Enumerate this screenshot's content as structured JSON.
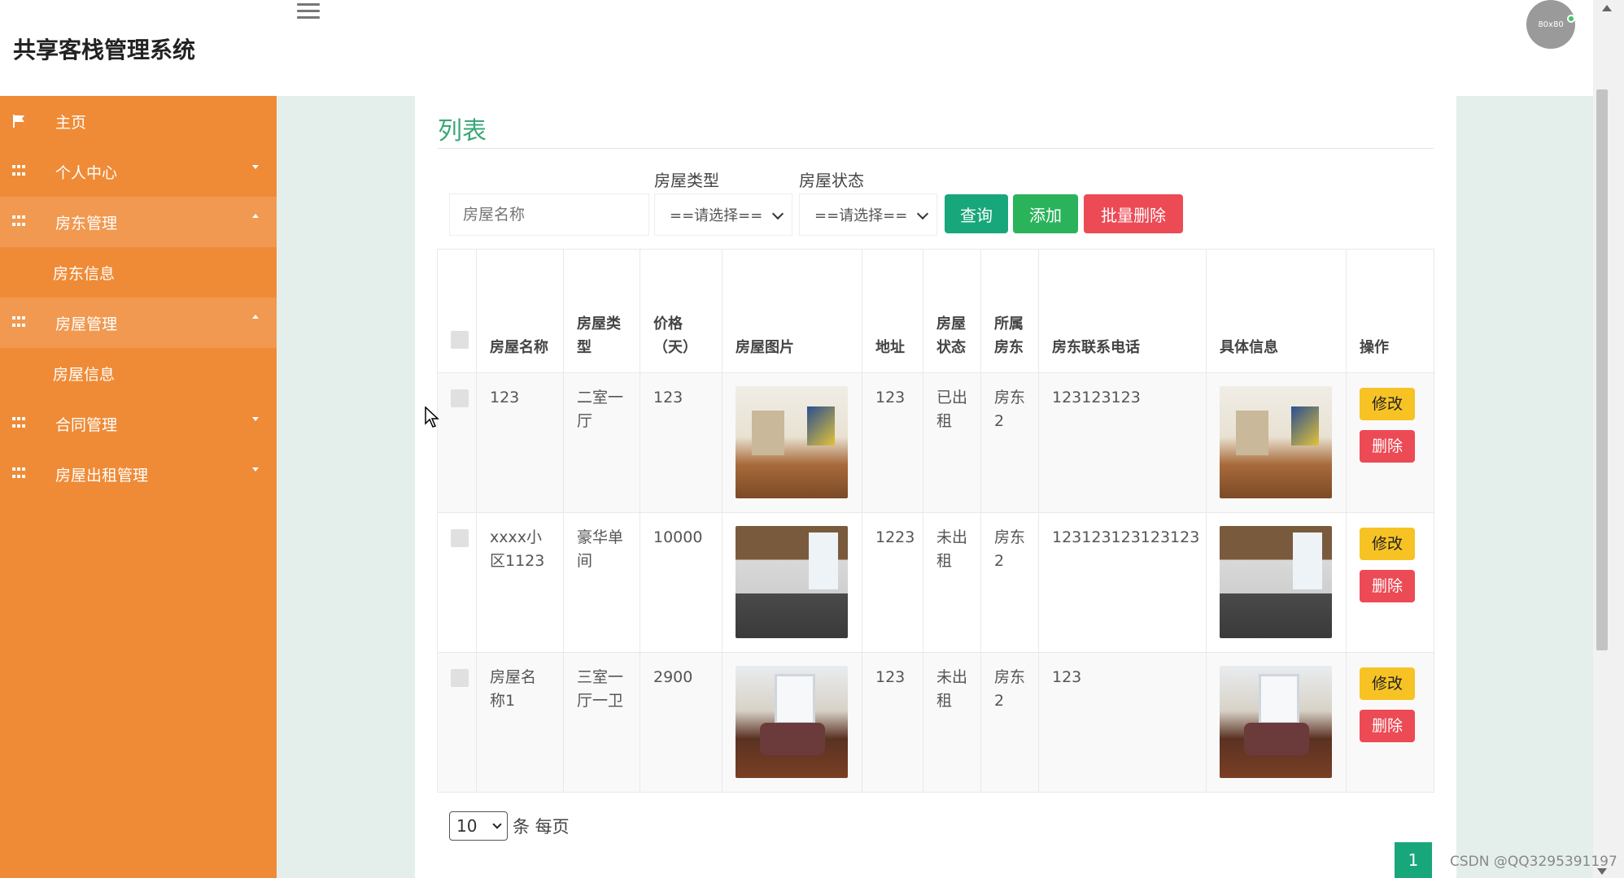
{
  "header": {
    "app_title": "共享客栈管理系统",
    "avatar_text": "80x80"
  },
  "sidebar": {
    "items": [
      {
        "label": "主页",
        "icon": "flag-icon"
      },
      {
        "label": "个人中心",
        "icon": "grid-icon"
      },
      {
        "label": "房东管理",
        "icon": "grid-icon"
      },
      {
        "label": "房东信息"
      },
      {
        "label": "房屋管理",
        "icon": "grid-icon"
      },
      {
        "label": "房屋信息"
      },
      {
        "label": "合同管理",
        "icon": "grid-icon"
      },
      {
        "label": "房屋出租管理",
        "icon": "grid-icon"
      }
    ]
  },
  "main": {
    "title": "列表",
    "filters": {
      "name_placeholder": "房屋名称",
      "type_label": "房屋类型",
      "type_value": "==请选择==",
      "status_label": "房屋状态",
      "status_value": "==请选择=="
    },
    "buttons": {
      "query": "查询",
      "add": "添加",
      "batch_delete": "批量删除"
    },
    "table": {
      "columns": [
        "房屋名称",
        "房屋类型",
        "价格（天）",
        "房屋图片",
        "地址",
        "房屋状态",
        "所属房东",
        "房东联系电话",
        "具体信息",
        "操作"
      ],
      "rows": [
        {
          "name": "123",
          "type": "二室一厅",
          "price": "123",
          "address": "123",
          "status": "已出租",
          "landlord": "房东2",
          "phone": "123123123",
          "image": "living-room"
        },
        {
          "name": "xxxx小区1123",
          "type": "豪华单间",
          "price": "10000",
          "address": "1223",
          "status": "未出租",
          "landlord": "房东2",
          "phone": "123123123123123",
          "image": "kitchen"
        },
        {
          "name": "房屋名称1",
          "type": "三室一厅一卫",
          "price": "2900",
          "address": "123",
          "status": "未出租",
          "landlord": "房东2",
          "phone": "123",
          "image": "dining-room"
        }
      ],
      "edit_label": "修改",
      "delete_label": "删除"
    },
    "pagination": {
      "page_size": "10",
      "per_page_label": "条 每页",
      "current_page": "1"
    }
  },
  "watermark": "CSDN @QQ3295391197",
  "colors": {
    "sidebar": "#ef8b37",
    "accent_green": "#18a77a",
    "add_green": "#2bb35b",
    "danger": "#ec4a55",
    "warning": "#f7c324",
    "title_green": "#3aa776"
  }
}
